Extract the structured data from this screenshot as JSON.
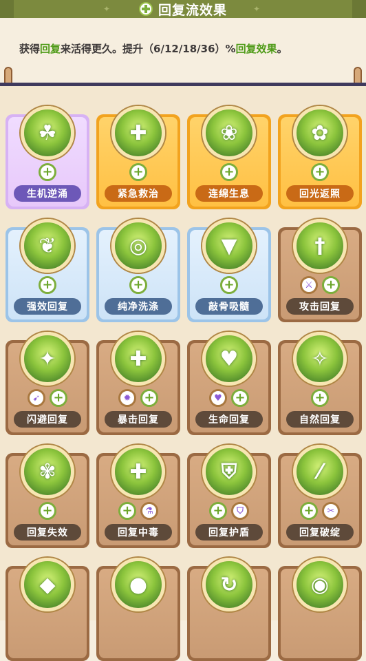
{
  "header": {
    "title": "回复流效果",
    "icon": "heal-plus-icon"
  },
  "description": {
    "prefix": "获得",
    "highlight1": "回复",
    "middle": "来活得更久。提升（6/12/18/36）%",
    "highlight2": "回复效果",
    "suffix": "。"
  },
  "cards": [
    {
      "label": "生机逆涌",
      "style": "purple",
      "icon": "sprout-creature-icon",
      "slots": [
        "plus"
      ]
    },
    {
      "label": "紧急救治",
      "style": "gold",
      "icon": "syringe-icon",
      "slots": [
        "plus"
      ]
    },
    {
      "label": "连绵生息",
      "style": "gold",
      "icon": "lotus-icon",
      "slots": [
        "plus"
      ]
    },
    {
      "label": "回光返照",
      "style": "gold",
      "icon": "petals-icon",
      "slots": [
        "plus"
      ]
    },
    {
      "label": "强效回复",
      "style": "blue",
      "icon": "seed-wings-icon",
      "slots": [
        "plus"
      ]
    },
    {
      "label": "纯净洗涤",
      "style": "blue",
      "icon": "swirl-icon",
      "slots": [
        "plus"
      ]
    },
    {
      "label": "敲骨吸髓",
      "style": "blue",
      "icon": "fang-mouth-icon",
      "slots": [
        "plus"
      ]
    },
    {
      "label": "攻击回复",
      "style": "brown",
      "icon": "sword-icon",
      "slots": [
        "type-sword",
        "plus"
      ]
    },
    {
      "label": "闪避回复",
      "style": "brown",
      "icon": "dodging-cat-icon",
      "slots": [
        "type-dodge",
        "plus"
      ]
    },
    {
      "label": "暴击回复",
      "style": "brown",
      "icon": "crit-plus-icon",
      "slots": [
        "type-crit",
        "plus"
      ]
    },
    {
      "label": "生命回复",
      "style": "brown",
      "icon": "heart-icon",
      "slots": [
        "type-heart",
        "plus"
      ]
    },
    {
      "label": "自然回复",
      "style": "brown",
      "icon": "winged-spirit-icon",
      "slots": [
        "plus"
      ]
    },
    {
      "label": "回复失效",
      "style": "brown",
      "icon": "wilted-plant-icon",
      "slots": [
        "plus"
      ]
    },
    {
      "label": "回复中毒",
      "style": "brown",
      "icon": "poison-plus-icon",
      "slots": [
        "plus",
        "type-potion"
      ]
    },
    {
      "label": "回复护盾",
      "style": "brown",
      "icon": "shield-plus-icon",
      "slots": [
        "plus",
        "type-shield"
      ]
    },
    {
      "label": "回复破绽",
      "style": "brown",
      "icon": "claw-slash-icon",
      "slots": [
        "plus",
        "type-break"
      ]
    },
    {
      "label": "",
      "style": "brown",
      "icon": "crystal-icon",
      "slots": []
    },
    {
      "label": "",
      "style": "brown",
      "icon": "bear-icon",
      "slots": []
    },
    {
      "label": "",
      "style": "brown",
      "icon": "cycle-icon",
      "slots": []
    },
    {
      "label": "",
      "style": "brown",
      "icon": "water-drop-icon",
      "slots": []
    }
  ],
  "colors": {
    "header": "#7c8a3e",
    "highlight": "#4d9a16",
    "background": "#f3e7d0"
  }
}
